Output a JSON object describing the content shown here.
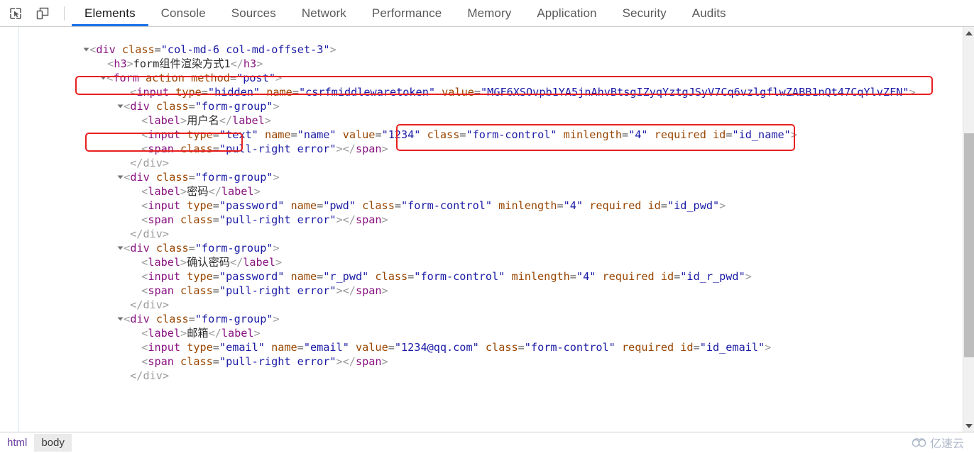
{
  "toolbar": {
    "inspect_icon": "inspect-cursor-icon",
    "device_icon": "device-toolbar-icon"
  },
  "tabs": [
    {
      "label": "Elements",
      "active": true
    },
    {
      "label": "Console",
      "active": false
    },
    {
      "label": "Sources",
      "active": false
    },
    {
      "label": "Network",
      "active": false
    },
    {
      "label": "Performance",
      "active": false
    },
    {
      "label": "Memory",
      "active": false
    },
    {
      "label": "Application",
      "active": false
    },
    {
      "label": "Security",
      "active": false
    },
    {
      "label": "Audits",
      "active": false
    }
  ],
  "code": {
    "div_open_tag": "div",
    "div_class_attr": "class",
    "div_class_value": "\"col-md-6 col-md-offset-3\"",
    "h3_tag": "h3",
    "h3_text": "form组件渲染方式1",
    "form_tag": "form",
    "form_action_attr": "action",
    "form_method_attr": "method",
    "form_method_value": "\"post\"",
    "input_tag": "input",
    "type_attr": "type",
    "name_attr": "name",
    "value_attr": "value",
    "class_attr": "class",
    "minlength_attr": "minlength",
    "required_attr": "required",
    "id_attr": "id",
    "hidden_value": "\"hidden\"",
    "csrf_name_value": "\"csrfmiddlewaretoken\"",
    "csrf_token_value": "\"MGF6XSOvpb1YA5jnAhvBtsgIZyqYztgJSyV7Cq6vzlgflwZABB1nQt47CqYlvZFN\"",
    "form_group_value": "\"form-group\"",
    "label_tag": "label",
    "label_username": "用户名",
    "label_password": "密码",
    "label_confirm_password": "确认密码",
    "label_email": "邮箱",
    "text_value": "\"text\"",
    "password_value": "\"password\"",
    "email_value": "\"email\"",
    "name_name_value": "\"name\"",
    "name_value_1234": "\"1234\"",
    "form_control_value": "\"form-control\"",
    "minlength_4": "\"4\"",
    "id_name_value": "\"id_name\"",
    "pwd_name_value": "\"pwd\"",
    "id_pwd_value": "\"id_pwd\"",
    "r_pwd_name_value": "\"r_pwd\"",
    "id_r_pwd_value": "\"id_r_pwd\"",
    "email_name_value": "\"email\"",
    "email_value_text": "\"1234@qq.com\"",
    "id_email_value": "\"id_email\"",
    "span_tag": "span",
    "span_class_value": "\"pull-right error\"",
    "close_div": "</div>"
  },
  "breadcrumb": [
    {
      "label": "html",
      "selected": false
    },
    {
      "label": "body",
      "selected": true
    }
  ],
  "watermark": {
    "icon": "cloud-logo-icon",
    "text": "亿速云"
  },
  "colors": {
    "accent": "#1a73e8",
    "annotation": "#e8201f",
    "tag": "#881280",
    "attr_name": "#994500",
    "attr_value": "#1a1aa6"
  }
}
